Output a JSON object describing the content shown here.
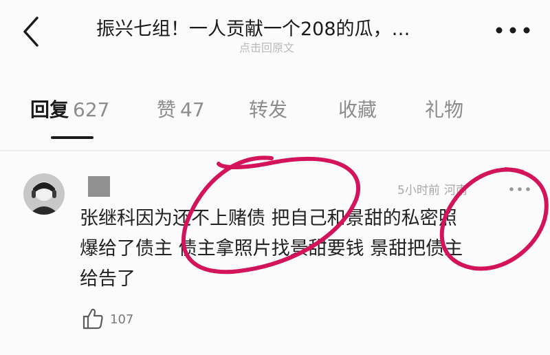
{
  "header": {
    "title": "振兴七组！一人贡献一个208的瓜，…",
    "subtitle": "点击回原文",
    "back_icon": "chevron-left-icon",
    "more_icon": "more-horizontal-icon"
  },
  "tabs": [
    {
      "label": "回复",
      "count": "627",
      "active": true
    },
    {
      "label": "赞",
      "count": "47",
      "active": false
    },
    {
      "label": "转发",
      "count": "",
      "active": false
    },
    {
      "label": "收藏",
      "count": "",
      "active": false
    },
    {
      "label": "礼物",
      "count": "",
      "active": false
    }
  ],
  "comment": {
    "time": "5小时前",
    "location": "河南",
    "lines": [
      "张继科因为还不上赌债 把自己和景甜的私密照",
      "爆给了债主 债主拿照片找景甜要钱 景甜把债主",
      "给告了"
    ],
    "likes": "107",
    "like_icon": "thumbs-up-icon",
    "more_icon": "more-horizontal-icon"
  },
  "colors": {
    "annotation": "#d4145a",
    "divider": "#eeeeee",
    "muted_text": "#a8a8a8"
  }
}
